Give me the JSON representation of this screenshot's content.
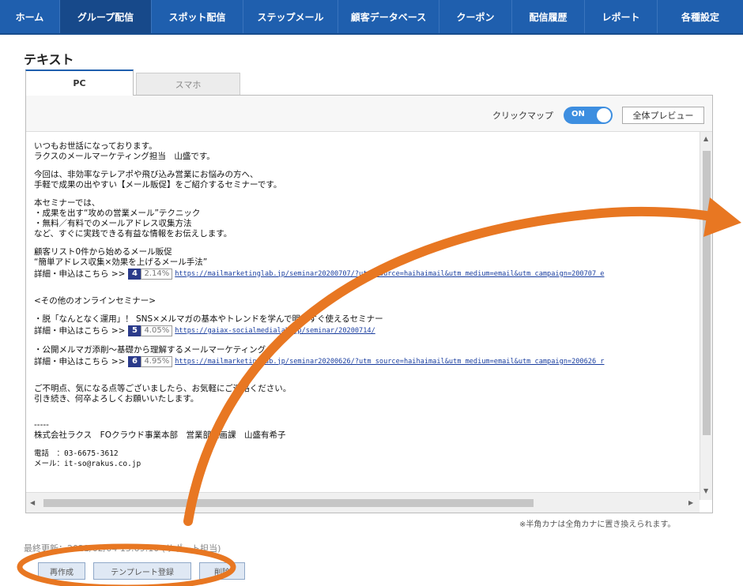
{
  "nav": {
    "items": [
      "ホーム",
      "グループ配信",
      "スポット配信",
      "ステップメール",
      "顧客データベース",
      "クーポン",
      "配信履歴",
      "レポート",
      "各種設定"
    ],
    "active_index": 1
  },
  "section_title": "テキスト",
  "tabs": {
    "pc": "PC",
    "sp": "スマホ"
  },
  "toolbar": {
    "clickmap_label": "クリックマップ",
    "toggle_label": "ON",
    "preview_label": "全体プレビュー"
  },
  "content": {
    "greeting": [
      "いつもお世話になっております。",
      "ラクスのメールマーケティング担当　山盛です。"
    ],
    "intro": [
      "今回は、非効率なテレアポや飛び込み営業にお悩みの方へ、",
      "手軽で成果の出やすい【メール販促】をご紹介するセミナーです。"
    ],
    "points": [
      "本セミナーでは、",
      "・成果を出す“攻めの営業メール”テクニック",
      "・無料／有料でのメールアドレス収集方法",
      "など、すぐに実践できる有益な情報をお伝えします。"
    ],
    "seminar1": [
      "顧客リスト0件から始めるメール販促",
      "“簡単アドレス収集×効果を上げるメール手法”"
    ],
    "link1": {
      "label": "詳細・申込はこちら >>",
      "badge": "4",
      "rate": "2.14%",
      "url": "https://mailmarketinglab.jp/seminar20200707/?utm_source=haihaimail&utm_medium=email&utm_campaign=200707_e"
    },
    "other_heading": "<その他のオンラインセミナー>",
    "seminar2": "・脱「なんとなく運用」！ SNS×メルマガの基本やトレンドを学んで明日すぐ使えるセミナー",
    "link2": {
      "label": "詳細・申込はこちら >>",
      "badge": "5",
      "rate": "4.05%",
      "url": "https://gaiax-socialmedialab.jp/seminar/20200714/"
    },
    "seminar3": "・公開メルマガ添削～基礎から理解するメールマーケティング～",
    "link3": {
      "label": "詳細・申込はこちら >>",
      "badge": "6",
      "rate": "4.95%",
      "url": "https://mailmarketinglab.jp/seminar20200626/?utm_source=haihaimail&utm_medium=email&utm_campaign=200626_r"
    },
    "closing": [
      "ご不明点、気になる点等ございましたら、お気軽にご連絡ください。",
      "引き続き、何卒よろしくお願いいたします。"
    ],
    "divider": "-----",
    "signature": "株式会社ラクス　FOクラウド事業本部　営業部企画課　山盛有希子",
    "phone": "電話　：03-6675-3612",
    "email": "メール：it-so@rakus.co.jp"
  },
  "note": "※半角カナは全角カナに置き換えられます。",
  "updated": "最終更新：2021/02/04 15:09:10 (サポート担当)",
  "buttons": {
    "recreate": "再作成",
    "template": "テンプレート登録",
    "delete": "削除"
  },
  "colors": {
    "nav_bg": "#1f5fae",
    "accent_orange": "#e87722",
    "badge_bg": "#2a3a8a"
  }
}
